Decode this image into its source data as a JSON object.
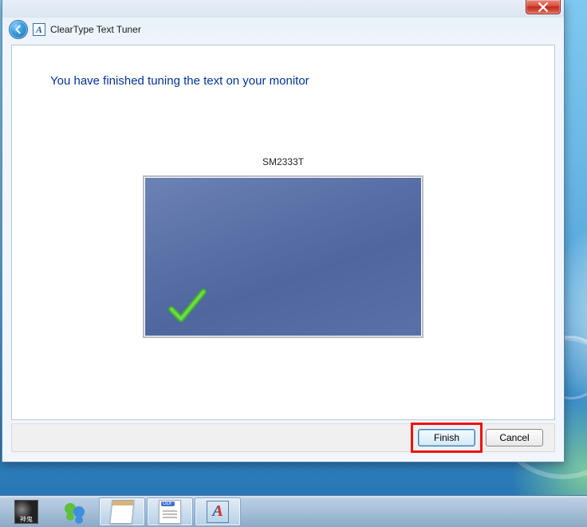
{
  "window": {
    "title": "ClearType Text Tuner",
    "heading": "You have finished tuning the text on your monitor",
    "monitor_name": "SM2333T",
    "buttons": {
      "finish": "Finish",
      "cancel": "Cancel"
    }
  },
  "taskbar": {
    "items": [
      {
        "name": "thumbnail-app"
      },
      {
        "name": "messenger-app"
      },
      {
        "name": "notepad-app"
      },
      {
        "name": "odf-document-app"
      },
      {
        "name": "cleartype-tuner-app"
      }
    ]
  }
}
